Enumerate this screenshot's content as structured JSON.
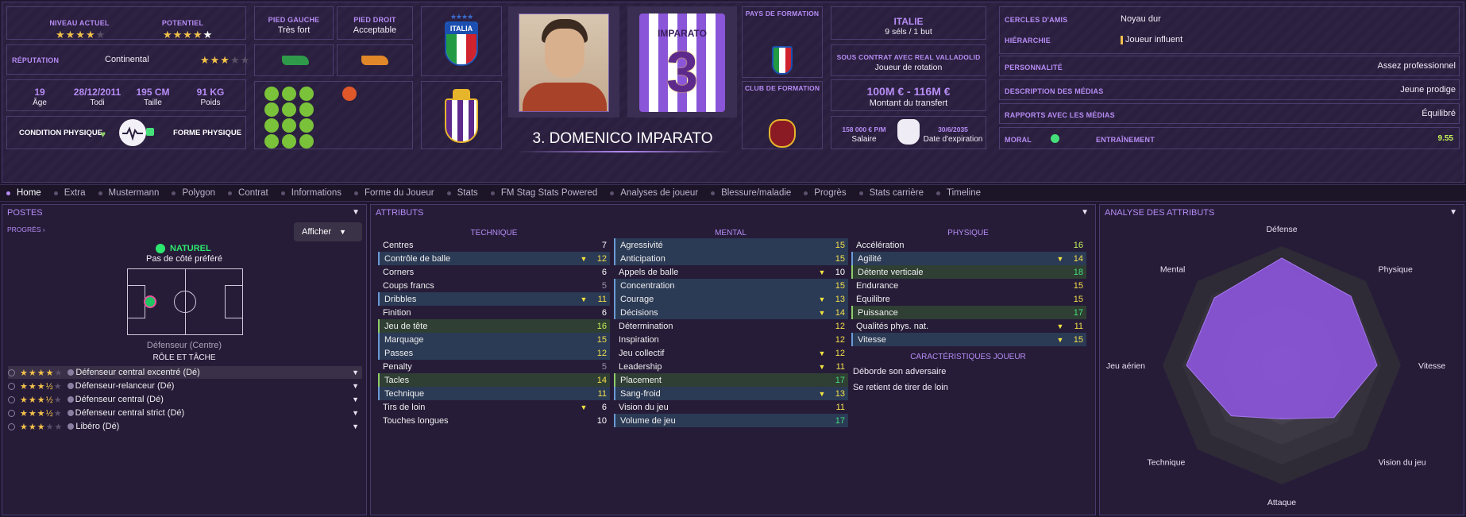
{
  "header": {
    "current_level_label": "NIVEAU ACTUEL",
    "current_level_stars": "★★★★",
    "current_level_stars_dim": "★",
    "potential_label": "POTENTIEL",
    "potential_stars": "★★★★",
    "potential_stars_white": "★",
    "reputation_label": "RÉPUTATION",
    "reputation_value": "Continental",
    "reputation_stars": "★★★",
    "reputation_stars_dim": "★★",
    "age_value": "19",
    "age_label": "Âge",
    "dob_value": "28/12/2011",
    "dob_label": "Todi",
    "height_value": "195 CM",
    "height_label": "Taille",
    "weight_value": "91 KG",
    "weight_label": "Poids",
    "condition_label": "CONDITION PHYSIQUE",
    "fitness_label": "FORME PHYSIQUE",
    "left_foot_label": "PIED GAUCHE",
    "left_foot_value": "Très fort",
    "right_foot_label": "PIED DROIT",
    "right_foot_value": "Acceptable",
    "player_name": "3. DOMENICO IMPARATO",
    "shirt_name": "IMPARATO",
    "shirt_number": "3",
    "nation_badge_text": "ITALIA",
    "training_country_label": "PAYS DE FORMATION",
    "training_club_label": "CLUB DE FORMATION",
    "nation": "ITALIE",
    "caps": "9 séls / 1 but",
    "contract_label": "SOUS CONTRAT AVEC REAL VALLADOLID",
    "contract_role": "Joueur de rotation",
    "transfer_value": "100M € - 116M €",
    "transfer_label": "Montant du transfert",
    "salary_value": "158 000 € P/M",
    "salary_label": "Salaire",
    "expiry_value": "30/6/2035",
    "expiry_label": "Date d'expiration",
    "social_label": "CERCLES D'AMIS",
    "social_value": "Noyau dur",
    "hierarchy_label": "HIÉRARCHIE",
    "hierarchy_value": "Joueur influent",
    "personality_label": "PERSONNALITÉ",
    "personality_value": "Assez professionnel",
    "media_desc_label": "DESCRIPTION DES MÉDIAS",
    "media_desc_value": "Jeune prodige",
    "media_rel_label": "RAPPORTS AVEC LES MÉDIAS",
    "media_rel_value": "Équilibré",
    "morale_label": "MORAL",
    "training_label": "ENTRAÎNEMENT",
    "training_value": "9.55"
  },
  "tabs": [
    "Home",
    "Extra",
    "Mustermann",
    "Polygon",
    "Contrat",
    "Informations",
    "Forme du Joueur",
    "Stats",
    "FM Stag Stats Powered",
    "Analyses de joueur",
    "Blessure/maladie",
    "Progrès",
    "Stats carrière",
    "Timeline"
  ],
  "positions": {
    "title": "POSTES",
    "progress_link": "PROGRÈS",
    "show_button": "Afficher",
    "natural": "NATUREL",
    "no_side": "Pas de côté préféré",
    "position_name": "Défenseur (Centre)",
    "role_title": "RÔLE ET TÂCHE",
    "roles": [
      {
        "stars": "★★★★",
        "dim": "★",
        "name": "Défenseur central excentré (Dé)"
      },
      {
        "stars": "★★★½",
        "dim": "★",
        "name": "Défenseur-relanceur (Dé)"
      },
      {
        "stars": "★★★½",
        "dim": "★",
        "name": "Défenseur central (Dé)"
      },
      {
        "stars": "★★★½",
        "dim": "★",
        "name": "Défenseur central strict (Dé)"
      },
      {
        "stars": "★★★",
        "dim": "★★",
        "name": "Libéro (Dé)"
      }
    ]
  },
  "attributes": {
    "title": "ATTRIBUTS",
    "technical_title": "TECHNIQUE",
    "mental_title": "MENTAL",
    "physical_title": "PHYSIQUE",
    "traits_title": "CARACTÉRISTIQUES JOUEUR",
    "technical": [
      {
        "name": "Centres",
        "value": "7",
        "hl": "",
        "arrow": "",
        "c": "c-white"
      },
      {
        "name": "Contrôle de balle",
        "value": "12",
        "hl": "blue",
        "arrow": "▼",
        "c": "c-yellow"
      },
      {
        "name": "Corners",
        "value": "6",
        "hl": "",
        "arrow": "",
        "c": "c-white"
      },
      {
        "name": "Coups francs",
        "value": "5",
        "hl": "",
        "arrow": "",
        "c": "c-grey"
      },
      {
        "name": "Dribbles",
        "value": "11",
        "hl": "blue",
        "arrow": "▼",
        "c": "c-yellow"
      },
      {
        "name": "Finition",
        "value": "6",
        "hl": "",
        "arrow": "",
        "c": "c-white"
      },
      {
        "name": "Jeu de tête",
        "value": "16",
        "hl": "green",
        "arrow": "",
        "c": "c-lgreen"
      },
      {
        "name": "Marquage",
        "value": "15",
        "hl": "blue",
        "arrow": "",
        "c": "c-yellow"
      },
      {
        "name": "Passes",
        "value": "12",
        "hl": "blue",
        "arrow": "",
        "c": "c-yellow"
      },
      {
        "name": "Penalty",
        "value": "5",
        "hl": "",
        "arrow": "",
        "c": "c-grey"
      },
      {
        "name": "Tacles",
        "value": "14",
        "hl": "green",
        "arrow": "",
        "c": "c-yellow"
      },
      {
        "name": "Technique",
        "value": "11",
        "hl": "blue",
        "arrow": "",
        "c": "c-yellow"
      },
      {
        "name": "Tirs de loin",
        "value": "6",
        "hl": "",
        "arrow": "▼",
        "c": "c-white"
      },
      {
        "name": "Touches longues",
        "value": "10",
        "hl": "",
        "arrow": "",
        "c": "c-white"
      }
    ],
    "mental": [
      {
        "name": "Agressivité",
        "value": "15",
        "hl": "blue",
        "arrow": "",
        "c": "c-yellow"
      },
      {
        "name": "Anticipation",
        "value": "15",
        "hl": "blue",
        "arrow": "",
        "c": "c-yellow"
      },
      {
        "name": "Appels de balle",
        "value": "10",
        "hl": "",
        "arrow": "▼",
        "c": "c-white"
      },
      {
        "name": "Concentration",
        "value": "15",
        "hl": "blue",
        "arrow": "",
        "c": "c-yellow"
      },
      {
        "name": "Courage",
        "value": "13",
        "hl": "blue",
        "arrow": "▼",
        "c": "c-yellow"
      },
      {
        "name": "Décisions",
        "value": "14",
        "hl": "blue",
        "arrow": "▼",
        "c": "c-yellow"
      },
      {
        "name": "Détermination",
        "value": "12",
        "hl": "",
        "arrow": "",
        "c": "c-yellow"
      },
      {
        "name": "Inspiration",
        "value": "12",
        "hl": "",
        "arrow": "",
        "c": "c-yellow"
      },
      {
        "name": "Jeu collectif",
        "value": "12",
        "hl": "",
        "arrow": "▼",
        "c": "c-yellow"
      },
      {
        "name": "Leadership",
        "value": "11",
        "hl": "",
        "arrow": "▼",
        "c": "c-yellow"
      },
      {
        "name": "Placement",
        "value": "17",
        "hl": "green",
        "arrow": "",
        "c": "c-green"
      },
      {
        "name": "Sang-froid",
        "value": "13",
        "hl": "blue",
        "arrow": "▼",
        "c": "c-yellow"
      },
      {
        "name": "Vision du jeu",
        "value": "11",
        "hl": "",
        "arrow": "",
        "c": "c-yellow"
      },
      {
        "name": "Volume de jeu",
        "value": "17",
        "hl": "blue",
        "arrow": "",
        "c": "c-green"
      }
    ],
    "physical": [
      {
        "name": "Accélération",
        "value": "16",
        "hl": "",
        "arrow": "",
        "c": "c-lgreen"
      },
      {
        "name": "Agilité",
        "value": "14",
        "hl": "blue",
        "arrow": "▼",
        "c": "c-yellow"
      },
      {
        "name": "Détente verticale",
        "value": "18",
        "hl": "green",
        "arrow": "",
        "c": "c-green"
      },
      {
        "name": "Endurance",
        "value": "15",
        "hl": "",
        "arrow": "",
        "c": "c-yellow"
      },
      {
        "name": "Équilibre",
        "value": "15",
        "hl": "",
        "arrow": "",
        "c": "c-yellow"
      },
      {
        "name": "Puissance",
        "value": "17",
        "hl": "green",
        "arrow": "",
        "c": "c-green"
      },
      {
        "name": "Qualités phys. nat.",
        "value": "11",
        "hl": "",
        "arrow": "▼",
        "c": "c-yellow"
      },
      {
        "name": "Vitesse",
        "value": "15",
        "hl": "blue",
        "arrow": "▼",
        "c": "c-yellow"
      }
    ],
    "traits": [
      "Déborde son adversaire",
      "Se retient de tirer de loin"
    ]
  },
  "analysis": {
    "title": "ANALYSE DES ATTRIBUTS",
    "axes": [
      "Défense",
      "Physique",
      "Vitesse",
      "Vision du jeu",
      "Attaque",
      "Technique",
      "Jeu aérien",
      "Mental"
    ],
    "values": [
      0.9,
      0.82,
      0.8,
      0.62,
      0.45,
      0.6,
      0.8,
      0.8
    ],
    "fill_color": "#8a55d8"
  }
}
